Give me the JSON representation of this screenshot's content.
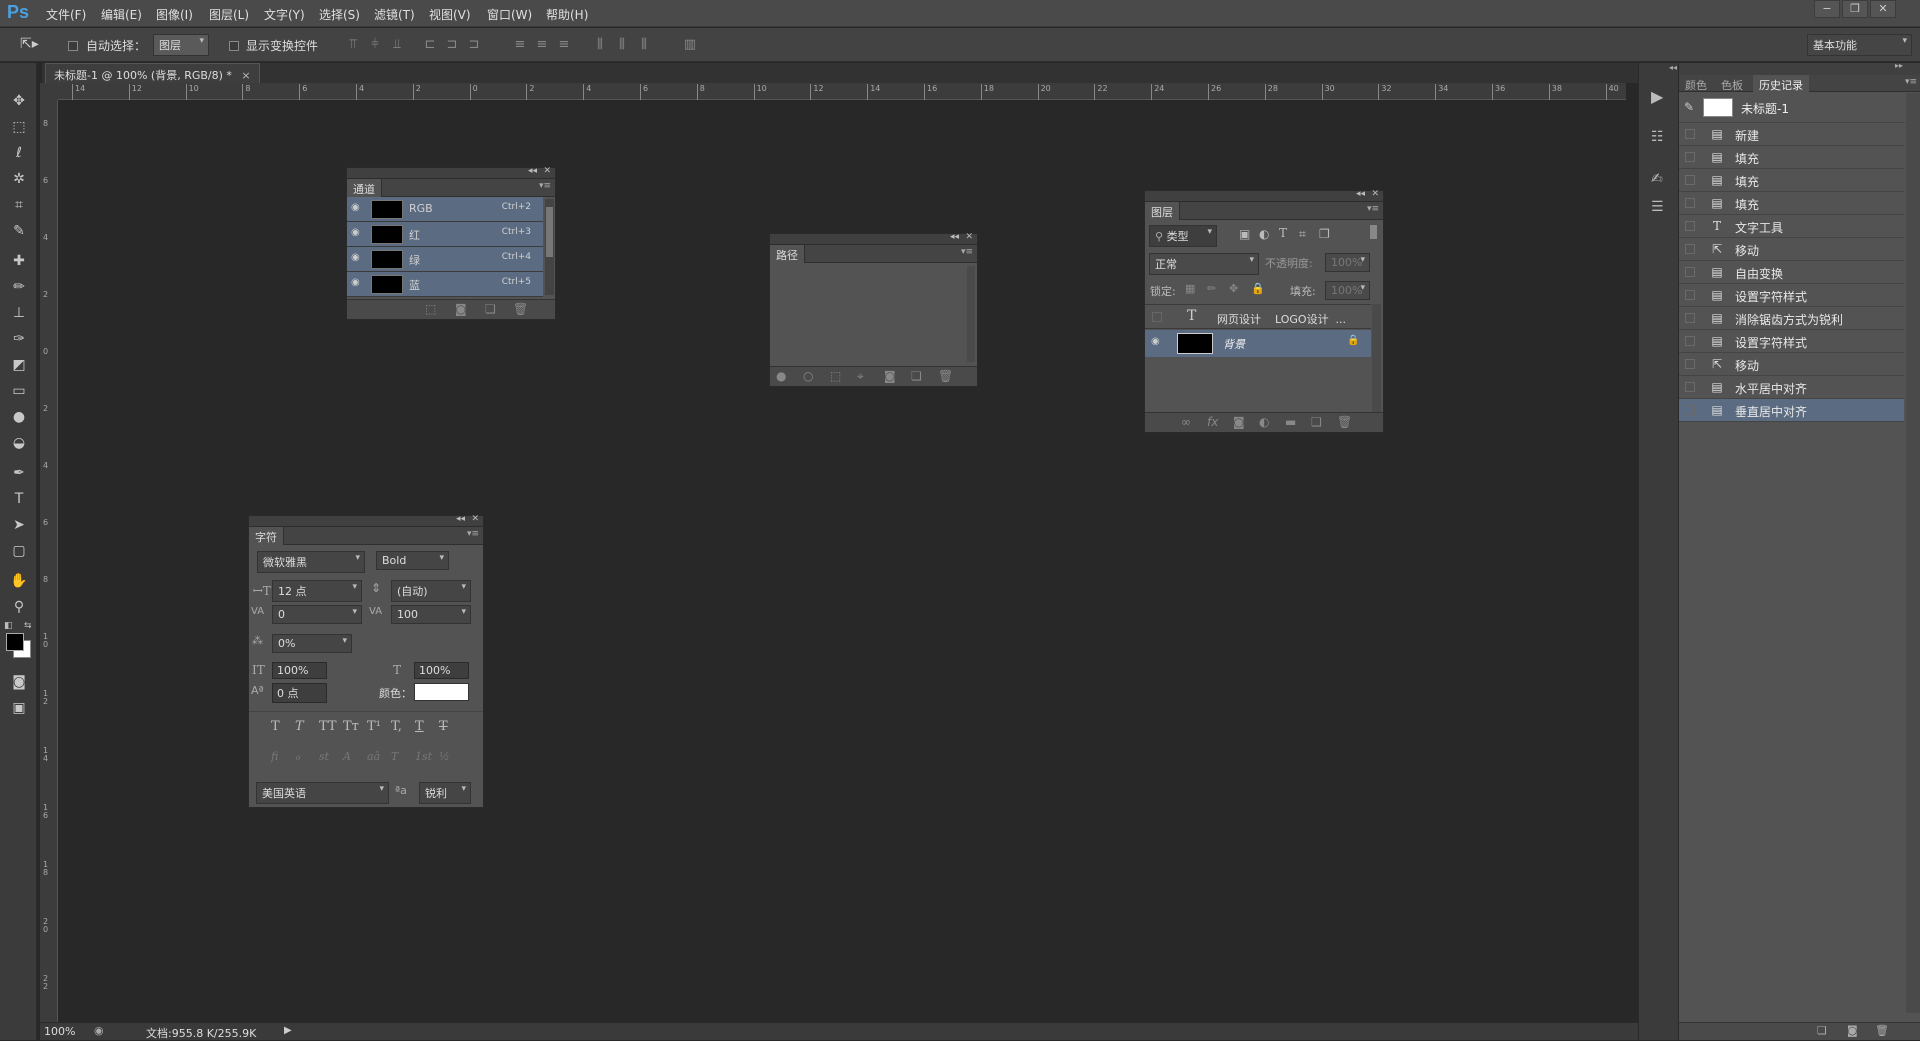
{
  "app": {
    "logo": "Ps"
  },
  "menu": [
    "文件(F)",
    "编辑(E)",
    "图像(I)",
    "图层(L)",
    "文字(Y)",
    "选择(S)",
    "滤镜(T)",
    "视图(V)",
    "窗口(W)",
    "帮助(H)"
  ],
  "window_controls": [
    "−",
    "❐",
    "✕"
  ],
  "options": {
    "auto_select_label": "自动选择：",
    "auto_select_value": "图层",
    "show_transform_label": "显示变换控件",
    "workspace": "基本功能"
  },
  "document": {
    "tab_title": "未标题-1 @ 100% (背景, RGB/8) *",
    "close": "×"
  },
  "ruler_h": [
    "14",
    "12",
    "10",
    "8",
    "6",
    "4",
    "2",
    "0",
    "2",
    "4",
    "6",
    "8",
    "10",
    "12",
    "14",
    "16",
    "18",
    "20",
    "22",
    "24",
    "26",
    "28",
    "30",
    "32",
    "34",
    "36",
    "38",
    "40"
  ],
  "ruler_v": [
    "8",
    "6",
    "4",
    "2",
    "0",
    "2",
    "4",
    "6",
    "8",
    "1 0",
    "1 2",
    "1 4",
    "1 6",
    "1 8",
    "2 0",
    "2 2"
  ],
  "status": {
    "zoom": "100%",
    "doc_info": "文档:955.8 K/255.9K"
  },
  "channels": {
    "title": "通道",
    "rows": [
      {
        "name": "RGB",
        "shortcut": "Ctrl+2"
      },
      {
        "name": "红",
        "shortcut": "Ctrl+3"
      },
      {
        "name": "绿",
        "shortcut": "Ctrl+4"
      },
      {
        "name": "蓝",
        "shortcut": "Ctrl+5"
      }
    ]
  },
  "paths": {
    "title": "路径"
  },
  "layers": {
    "title": "图层",
    "filter_kind": "类型",
    "blend_mode": "正常",
    "opacity_label": "不透明度:",
    "opacity_value": "100%",
    "lock_label": "锁定:",
    "fill_label": "填充:",
    "fill_value": "100%",
    "text_layer": "网页设计    LOGO设计  ...",
    "bg_layer": "背景"
  },
  "character": {
    "title": "字符",
    "font_family": "微软雅黑",
    "font_style": "Bold",
    "size": "12 点",
    "leading": "(自动)",
    "kerning": "0",
    "tracking": "100",
    "tsume": "0%",
    "vscale": "100%",
    "hscale": "100%",
    "baseline": "0 点",
    "color_label": "颜色：",
    "language": "美国英语",
    "aa_label": "ªa",
    "antialias": "锐利",
    "format_buttons": [
      "T",
      "T",
      "TT",
      "Tт",
      "T¹",
      "T,",
      "T",
      "T"
    ],
    "opentype_buttons": [
      "fi",
      "ℴ",
      "st",
      "A",
      "aā",
      "T",
      "1st",
      "½"
    ]
  },
  "right_tabs": [
    "颜色",
    "色板",
    "历史记录"
  ],
  "history": {
    "snapshot": "未标题-1",
    "items": [
      {
        "icon": "doc-icon",
        "label": "新建"
      },
      {
        "icon": "doc-icon",
        "label": "填充"
      },
      {
        "icon": "doc-icon",
        "label": "填充"
      },
      {
        "icon": "doc-icon",
        "label": "填充"
      },
      {
        "icon": "type-icon",
        "label": "文字工具"
      },
      {
        "icon": "move-icon",
        "label": "移动"
      },
      {
        "icon": "doc-icon",
        "label": "自由变换"
      },
      {
        "icon": "doc-icon",
        "label": "设置字符样式"
      },
      {
        "icon": "doc-icon",
        "label": "消除锯齿方式为锐利"
      },
      {
        "icon": "doc-icon",
        "label": "设置字符样式"
      },
      {
        "icon": "move-icon",
        "label": "移动"
      },
      {
        "icon": "doc-icon",
        "label": "水平居中对齐"
      },
      {
        "icon": "doc-icon",
        "label": "垂直居中对齐"
      }
    ]
  },
  "colors": {
    "selection": "#5b6b82",
    "char_color": "#ffffff",
    "canvas": "#282828"
  }
}
